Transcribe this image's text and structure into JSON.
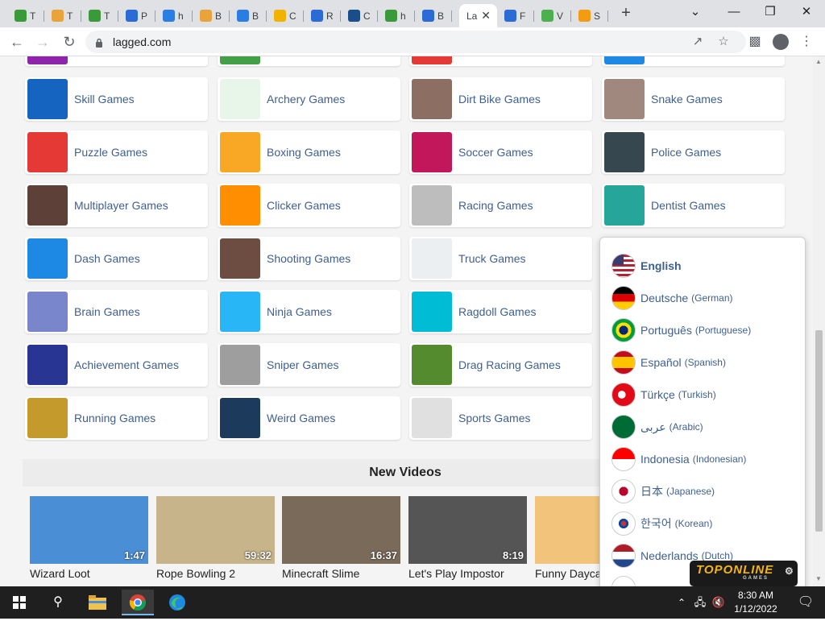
{
  "browser": {
    "tabs": [
      {
        "label": "T",
        "icon": "green-circle-icon",
        "color": "#3a9a3a"
      },
      {
        "label": "T",
        "icon": "drive-icon",
        "color": "#e8a33b"
      },
      {
        "label": "T",
        "icon": "green-circle-icon",
        "color": "#3a9a3a"
      },
      {
        "label": "P",
        "icon": "u-logo-icon",
        "color": "#2c6bd6"
      },
      {
        "label": "h",
        "icon": "bolt-icon",
        "color": "#2a7de1"
      },
      {
        "label": "B",
        "icon": "drive-icon",
        "color": "#e8a33b"
      },
      {
        "label": "B",
        "icon": "bolt-icon",
        "color": "#2a7de1"
      },
      {
        "label": "C",
        "icon": "asterisk-icon",
        "color": "#f0b400"
      },
      {
        "label": "R",
        "icon": "u-logo-icon",
        "color": "#2c6bd6"
      },
      {
        "label": "C",
        "icon": "gamepad-icon",
        "color": "#1a4e8a"
      },
      {
        "label": "h",
        "icon": "green-circle-icon",
        "color": "#3a9a3a"
      },
      {
        "label": "B",
        "icon": "u-logo-icon",
        "color": "#2c6bd6"
      },
      {
        "label": "La",
        "icon": "",
        "color": "#ffffff",
        "active": true
      },
      {
        "label": "F",
        "icon": "u-logo-icon",
        "color": "#2c6bd6"
      },
      {
        "label": "V",
        "icon": "swirl-icon",
        "color": "#4caf50"
      },
      {
        "label": "S",
        "icon": "sun-icon",
        "color": "#f39c12"
      }
    ],
    "url": "lagged.com"
  },
  "categories": [
    {
      "label": "Skill Games",
      "color": "#1565c0"
    },
    {
      "label": "Archery Games",
      "color": "#e8f5e9"
    },
    {
      "label": "Dirt Bike Games",
      "color": "#8d6e63"
    },
    {
      "label": "Snake Games",
      "color": "#a1887f"
    },
    {
      "label": "Puzzle Games",
      "color": "#e53935"
    },
    {
      "label": "Boxing Games",
      "color": "#f9a825"
    },
    {
      "label": "Soccer Games",
      "color": "#c2185b"
    },
    {
      "label": "Police Games",
      "color": "#37474f"
    },
    {
      "label": "Multiplayer Games",
      "color": "#5d4037"
    },
    {
      "label": "Clicker Games",
      "color": "#ff8f00"
    },
    {
      "label": "Racing Games",
      "color": "#bdbdbd"
    },
    {
      "label": "Dentist Games",
      "color": "#26a69a"
    },
    {
      "label": "Dash Games",
      "color": "#1e88e5"
    },
    {
      "label": "Shooting Games",
      "color": "#6d4c41"
    },
    {
      "label": "Truck Games",
      "color": "#eceff1"
    },
    {
      "label": "",
      "color": "#ffffff"
    },
    {
      "label": "Brain Games",
      "color": "#7986cb"
    },
    {
      "label": "Ninja Games",
      "color": "#29b6f6"
    },
    {
      "label": "Ragdoll Games",
      "color": "#00bcd4"
    },
    {
      "label": "",
      "color": "#ffffff"
    },
    {
      "label": "Achievement Games",
      "color": "#283593"
    },
    {
      "label": "Sniper Games",
      "color": "#9e9e9e"
    },
    {
      "label": "Drag Racing Games",
      "color": "#558b2f"
    },
    {
      "label": "",
      "color": "#ffffff"
    },
    {
      "label": "Running Games",
      "color": "#c59a2c"
    },
    {
      "label": "Weird Games",
      "color": "#1b3a5c"
    },
    {
      "label": "Sports Games",
      "color": "#e0e0e0"
    },
    {
      "label": "",
      "color": "#ffffff"
    }
  ],
  "videos_heading": "New Videos",
  "videos": [
    {
      "title": "Wizard Loot",
      "duration": "1:47",
      "color": "#4a8fd6"
    },
    {
      "title": "Rope Bowling 2",
      "duration": "59:32",
      "color": "#c8b48a"
    },
    {
      "title": "Minecraft Slime",
      "duration": "16:37",
      "color": "#7a6a5a"
    },
    {
      "title": "Let's Play Impostor",
      "duration": "8:19",
      "color": "#555555"
    },
    {
      "title": "Funny Dayca",
      "duration": "",
      "color": "#f2c37a"
    }
  ],
  "languages": [
    {
      "name": "English",
      "english": "",
      "selected": true,
      "flag": [
        "#b22234",
        "#ffffff",
        "#3c3b6e"
      ]
    },
    {
      "name": "Deutsche",
      "english": "(German)",
      "flag": [
        "#000000",
        "#dd0000",
        "#ffce00"
      ]
    },
    {
      "name": "Português",
      "english": "(Portuguese)",
      "flag": [
        "#009c3b",
        "#ffdf00",
        "#002776"
      ]
    },
    {
      "name": "Español",
      "english": "(Spanish)",
      "flag": [
        "#c60b1e",
        "#ffc400",
        "#c60b1e"
      ]
    },
    {
      "name": "Türkçe",
      "english": "(Turkish)",
      "flag": [
        "#e30a17",
        "#e30a17",
        "#e30a17"
      ]
    },
    {
      "name": "عربى",
      "english": "(Arabic)",
      "flag": [
        "#006c35",
        "#006c35",
        "#006c35"
      ]
    },
    {
      "name": "Indonesia",
      "english": "(Indonesian)",
      "flag": [
        "#ff0000",
        "#ffffff",
        "#ffffff"
      ]
    },
    {
      "name": "日本",
      "english": "(Japanese)",
      "flag": [
        "#ffffff",
        "#ffffff",
        "#ffffff"
      ]
    },
    {
      "name": "한국어",
      "english": "(Korean)",
      "flag": [
        "#ffffff",
        "#ffffff",
        "#ffffff"
      ]
    },
    {
      "name": "Nederlands",
      "english": "(Dutch)",
      "flag": [
        "#ae1c28",
        "#ffffff",
        "#21468b"
      ]
    }
  ],
  "ad_badge": {
    "brand": "TOPONLINE",
    "sub": "GAMES"
  },
  "taskbar": {
    "time": "8:30 AM",
    "date": "1/12/2022"
  }
}
